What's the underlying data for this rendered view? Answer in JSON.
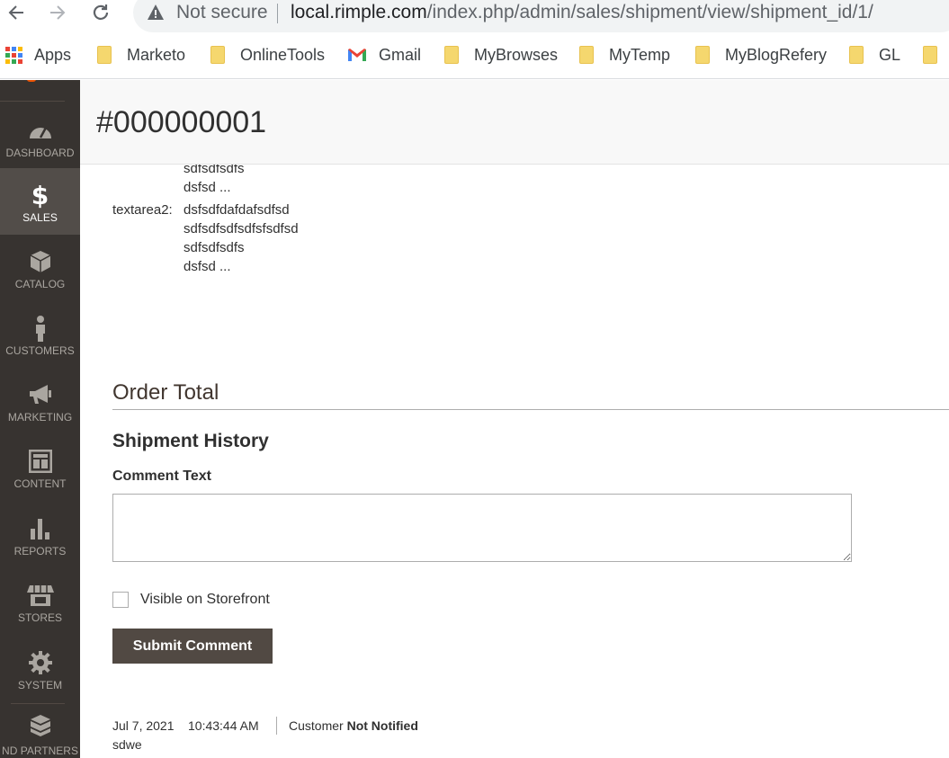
{
  "browser": {
    "insecure_label": "Not secure",
    "url_host": "local.rimple.com",
    "url_path": "/index.php/admin/sales/shipment/view/shipment_id/1/",
    "bookmarks": [
      {
        "label": "Apps",
        "icon": "apps-grid-icon"
      },
      {
        "label": "Marketo",
        "icon": "folder-icon"
      },
      {
        "label": "OnlineTools",
        "icon": "folder-icon"
      },
      {
        "label": "Gmail",
        "icon": "gmail-icon"
      },
      {
        "label": "MyBrowses",
        "icon": "folder-icon"
      },
      {
        "label": "MyTemp",
        "icon": "folder-icon"
      },
      {
        "label": "MyBlogRefery",
        "icon": "folder-icon"
      },
      {
        "label": "GL",
        "icon": "folder-icon"
      }
    ]
  },
  "sidebar": {
    "items": [
      {
        "label": "DASHBOARD",
        "icon": "dashboard-icon",
        "active": false
      },
      {
        "label": "SALES",
        "icon": "dollar-icon",
        "active": true
      },
      {
        "label": "CATALOG",
        "icon": "box-icon",
        "active": false
      },
      {
        "label": "CUSTOMERS",
        "icon": "person-icon",
        "active": false
      },
      {
        "label": "MARKETING",
        "icon": "megaphone-icon",
        "active": false
      },
      {
        "label": "CONTENT",
        "icon": "layout-icon",
        "active": false
      },
      {
        "label": "REPORTS",
        "icon": "bar-chart-icon",
        "active": false
      },
      {
        "label": "STORES",
        "icon": "store-icon",
        "active": false
      },
      {
        "label": "SYSTEM",
        "icon": "gear-icon",
        "active": false
      },
      {
        "label": "ND PARTNERS",
        "icon": "blocks-icon",
        "active": false
      }
    ]
  },
  "page": {
    "title": "#000000001"
  },
  "options": {
    "prev_lines": [
      "sdfsdfsdfs",
      "dsfsd ..."
    ],
    "textarea2_label": "textarea2:",
    "textarea2_lines": [
      "dsfsdfdafdafsdfsd",
      "sdfsdfsdfsdfsfsdfsd",
      "sdfsdfsdfs",
      "dsfsd ..."
    ]
  },
  "order_total": {
    "title": "Order Total"
  },
  "shipment_history": {
    "title": "Shipment History",
    "comment_label": "Comment Text",
    "comment_value": "",
    "visible_label": "Visible on Storefront",
    "visible_checked": false,
    "submit_label": "Submit Comment",
    "entries": [
      {
        "date": "Jul 7, 2021",
        "time": "10:43:44 AM",
        "customer_prefix": "Customer",
        "customer_status": "Not Notified",
        "note": "sdwe"
      }
    ]
  },
  "colors": {
    "sidebar_bg": "#373330",
    "sidebar_active": "#524d49",
    "button_bg": "#514943",
    "accent": "#eb5202"
  }
}
